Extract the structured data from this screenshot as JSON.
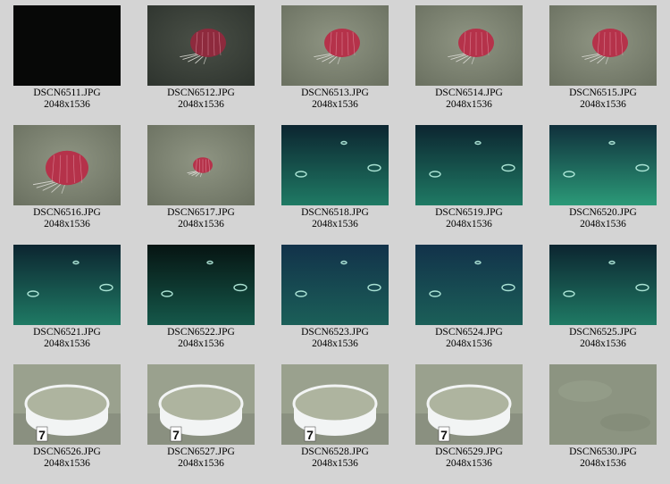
{
  "thumbnails": [
    {
      "filename": "DSCN6511.JPG",
      "dimensions": "2048x1536",
      "scene": "dark-frame"
    },
    {
      "filename": "DSCN6512.JPG",
      "dimensions": "2048x1536",
      "scene": "red-organism-dim"
    },
    {
      "filename": "DSCN6513.JPG",
      "dimensions": "2048x1536",
      "scene": "red-organism"
    },
    {
      "filename": "DSCN6514.JPG",
      "dimensions": "2048x1536",
      "scene": "red-organism"
    },
    {
      "filename": "DSCN6515.JPG",
      "dimensions": "2048x1536",
      "scene": "red-organism"
    },
    {
      "filename": "DSCN6516.JPG",
      "dimensions": "2048x1536",
      "scene": "red-organism-close"
    },
    {
      "filename": "DSCN6517.JPG",
      "dimensions": "2048x1536",
      "scene": "red-organism-small"
    },
    {
      "filename": "DSCN6518.JPG",
      "dimensions": "2048x1536",
      "scene": "water-rings"
    },
    {
      "filename": "DSCN6519.JPG",
      "dimensions": "2048x1536",
      "scene": "water-rings"
    },
    {
      "filename": "DSCN6520.JPG",
      "dimensions": "2048x1536",
      "scene": "water-rings-bright"
    },
    {
      "filename": "DSCN6521.JPG",
      "dimensions": "2048x1536",
      "scene": "water-rings"
    },
    {
      "filename": "DSCN6522.JPG",
      "dimensions": "2048x1536",
      "scene": "water-rings-dark"
    },
    {
      "filename": "DSCN6523.JPG",
      "dimensions": "2048x1536",
      "scene": "water-rings-blue"
    },
    {
      "filename": "DSCN6524.JPG",
      "dimensions": "2048x1536",
      "scene": "water-rings-blue"
    },
    {
      "filename": "DSCN6525.JPG",
      "dimensions": "2048x1536",
      "scene": "water-rings"
    },
    {
      "filename": "DSCN6526.JPG",
      "dimensions": "2048x1536",
      "scene": "white-ring-marker",
      "marker_label": "7"
    },
    {
      "filename": "DSCN6527.JPG",
      "dimensions": "2048x1536",
      "scene": "white-ring-marker",
      "marker_label": "7"
    },
    {
      "filename": "DSCN6528.JPG",
      "dimensions": "2048x1536",
      "scene": "white-ring-marker",
      "marker_label": "7"
    },
    {
      "filename": "DSCN6529.JPG",
      "dimensions": "2048x1536",
      "scene": "white-ring-marker",
      "marker_label": "7"
    },
    {
      "filename": "DSCN6530.JPG",
      "dimensions": "2048x1536",
      "scene": "seafloor"
    }
  ],
  "colors": {
    "background": "#d4d4d4",
    "seafloor": "#8e9482",
    "water_teal": "#1d6a5e",
    "water_blue": "#173a4c",
    "organism_red": "#b5324a",
    "ring_white": "#f2f4f4"
  }
}
